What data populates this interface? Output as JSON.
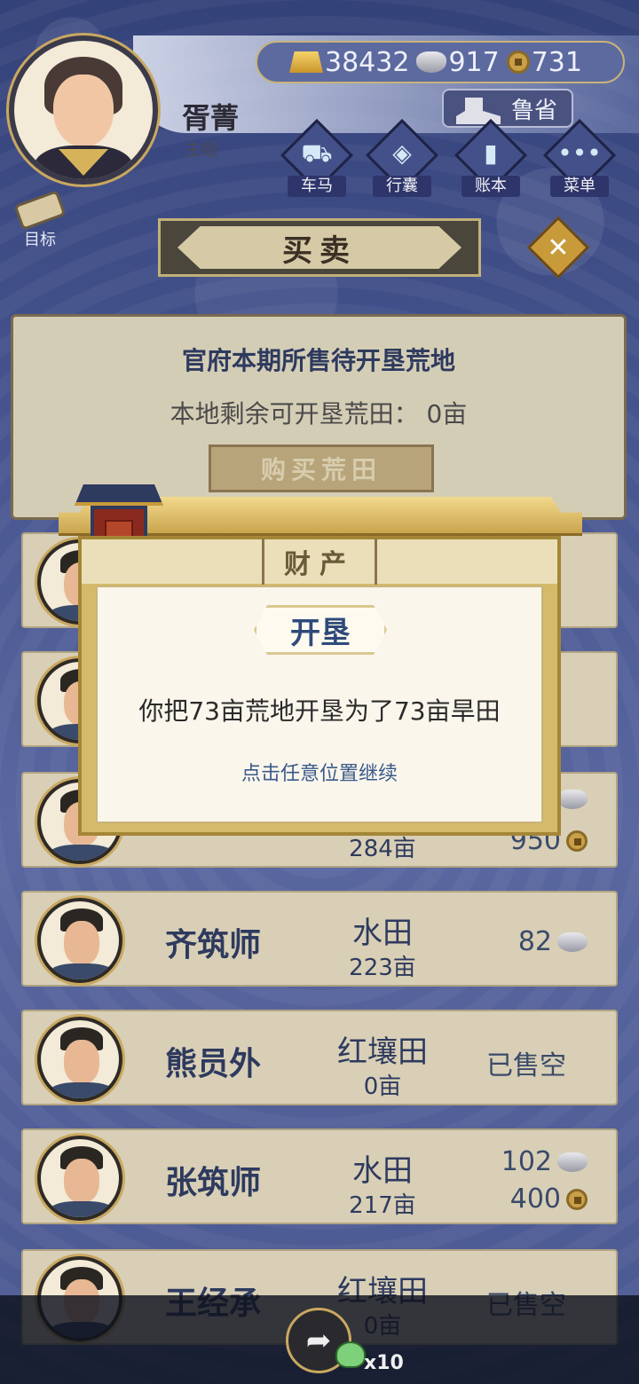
{
  "player": {
    "name": "胥菁",
    "title": "主绘"
  },
  "currency": {
    "gold": "38432",
    "silver": "917",
    "coin": "731"
  },
  "province": {
    "label": "鲁省",
    "icon": "official-seal-icon"
  },
  "nav": [
    {
      "label": "车马",
      "icon": "carriage-icon"
    },
    {
      "label": "行囊",
      "icon": "bag-icon"
    },
    {
      "label": "账本",
      "icon": "ledger-icon"
    },
    {
      "label": "菜单",
      "icon": "menu-dots-icon"
    }
  ],
  "target": {
    "label": "目标",
    "icon": "scroll-icon"
  },
  "banner": {
    "title": "买卖"
  },
  "close": {
    "icon": "close-icon",
    "glyph": "✕"
  },
  "land_panel": {
    "title": "官府本期所售待开垦荒地",
    "remaining": "本地剩余可开垦荒田： 0亩",
    "buy_button": "购买荒田"
  },
  "rows": [
    {
      "seller": "",
      "land_type": "",
      "area": "",
      "status": ""
    },
    {
      "seller": "",
      "land_type": "",
      "area": "",
      "status": ""
    },
    {
      "seller": "",
      "land_type": "",
      "area": "284亩",
      "price_silver": "",
      "price_coin": "950"
    },
    {
      "seller": "齐筑师",
      "land_type": "水田",
      "area": "223亩",
      "price_silver": "82"
    },
    {
      "seller": "熊员外",
      "land_type": "红壤田",
      "area": "0亩",
      "status": "已售空"
    },
    {
      "seller": "张筑师",
      "land_type": "水田",
      "area": "217亩",
      "price_silver": "102",
      "price_coin": "400"
    },
    {
      "seller": "王经承",
      "land_type": "红壤田",
      "area": "0亩",
      "status": "已售空"
    }
  ],
  "modal": {
    "header": "财产",
    "event_title": "开垦",
    "message": "你把73亩荒地开垦为了73亩旱田",
    "hint": "点击任意位置继续"
  },
  "share": {
    "count": "x10",
    "icon": "share-icon"
  },
  "colors": {
    "accent": "#2e3a5e",
    "gold": "#c9a048",
    "background": "#3e4b86"
  }
}
